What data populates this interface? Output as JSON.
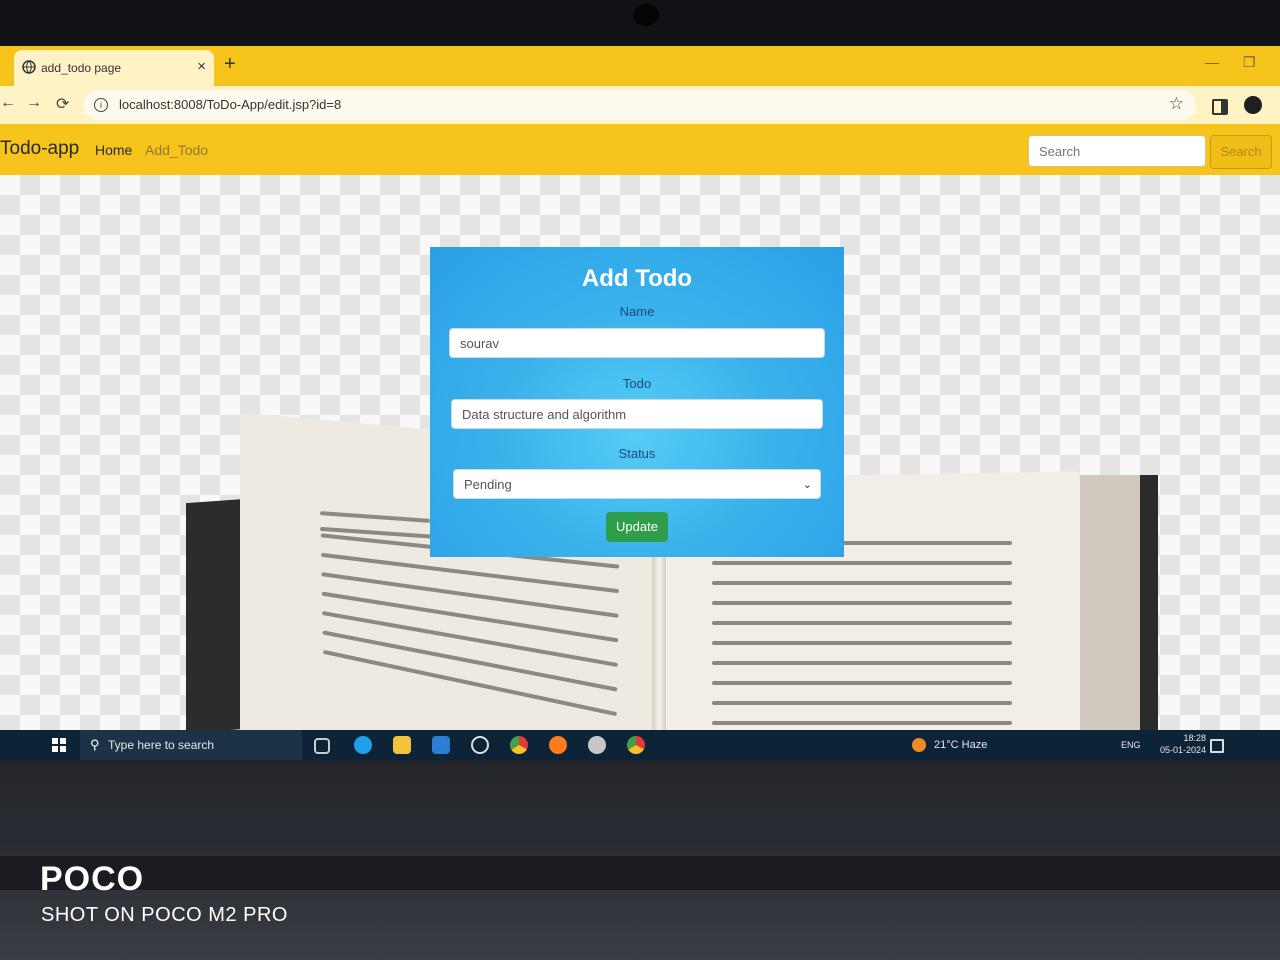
{
  "browser": {
    "tab_title": "add_todo page",
    "tab_close": "×",
    "new_tab": "+",
    "url": "localhost:8008/ToDo-App/edit.jsp?id=8",
    "back": "←",
    "forward": "→",
    "reload": "⟳",
    "bookmark": "☆",
    "minimize": "—",
    "maximize": "❐"
  },
  "navbar": {
    "brand": "Todo-app",
    "links": [
      "Home",
      "Add_Todo"
    ],
    "search_placeholder": "Search",
    "search_button": "Search"
  },
  "form": {
    "title": "Add Todo",
    "name_label": "Name",
    "name_value": "sourav",
    "todo_label": "Todo",
    "todo_value": "Data structure and algorithm",
    "status_label": "Status",
    "status_value": "Pending",
    "submit_label": "Update"
  },
  "taskbar": {
    "search_text": "Type here to search",
    "weather": "21°C  Haze",
    "language": "ENG",
    "time": "18:28",
    "date": "05-01-2024"
  },
  "watermark": {
    "brand": "POCO",
    "caption": "SHOT ON POCO M2 PRO"
  },
  "colors": {
    "navbar": "#f6c41b",
    "card": "#3ab3ec",
    "update_button": "#2f9e4b",
    "taskbar": "#0d2438"
  }
}
